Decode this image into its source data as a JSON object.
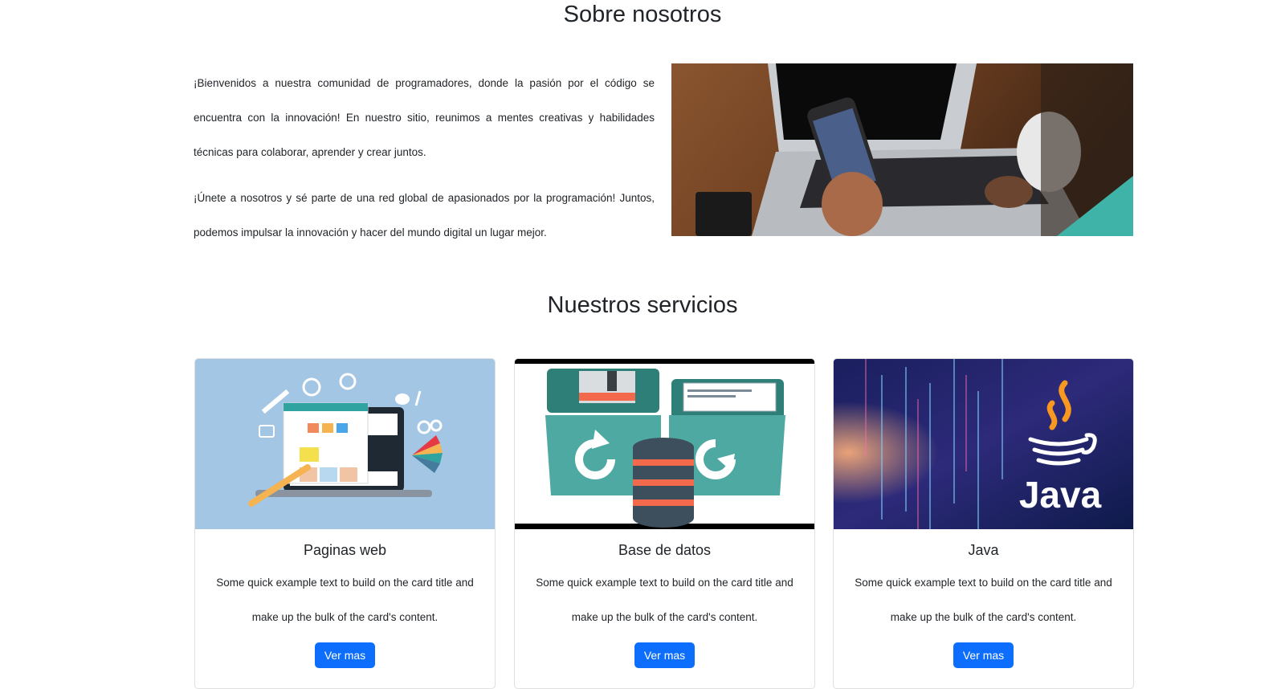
{
  "about": {
    "title": "Sobre nosotros",
    "paragraphs": [
      "¡Bienvenidos a nuestra comunidad de programadores, donde la pasión por el código se encuentra con la innovación! En nuestro sitio, reunimos a mentes creativas y habilidades técnicas para colaborar, aprender y crear juntos.",
      "¡Únete a nosotros y sé parte de una red global de apasionados por la programación! Juntos, podemos impulsar la innovación y hacer del mundo digital un lugar mejor."
    ]
  },
  "services": {
    "title": "Nuestros servicios",
    "cards": [
      {
        "title": "Paginas web",
        "text": "Some quick example text to build on the card title and make up the bulk of the card's content.",
        "button": "Ver mas"
      },
      {
        "title": "Base de datos",
        "text": "Some quick example text to build on the card title and make up the bulk of the card's content.",
        "button": "Ver mas"
      },
      {
        "title": "Java",
        "text": "Some quick example text to build on the card title and make up the bulk of the card's content.",
        "button": "Ver mas",
        "image_text": "Java"
      }
    ]
  },
  "colors": {
    "primary_button": "#0d6efd",
    "heading": "#212529"
  }
}
